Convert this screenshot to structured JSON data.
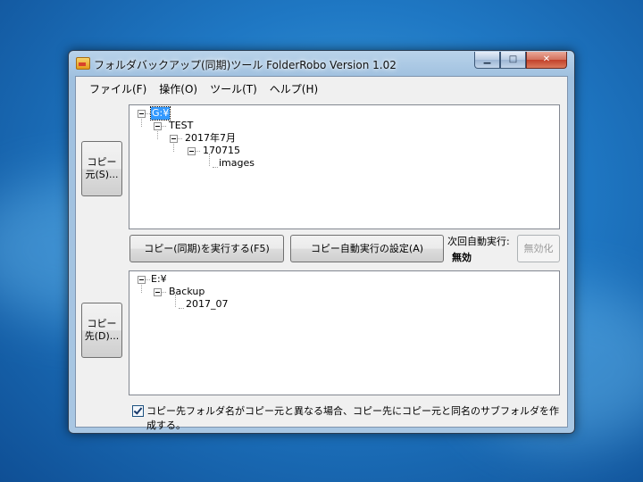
{
  "window": {
    "title": "フォルダバックアップ(同期)ツール FolderRobo Version 1.02"
  },
  "caption_buttons": {
    "minimize": "▁",
    "maximize": "□",
    "close": "✕"
  },
  "menu": [
    "ファイル(F)",
    "操作(O)",
    "ツール(T)",
    "ヘルプ(H)"
  ],
  "source_button": {
    "line1": "コピー",
    "line2": "元(S)..."
  },
  "dest_button": {
    "line1": "コピー",
    "line2": "先(D)..."
  },
  "source_tree": {
    "root": "G:¥",
    "level1": "TEST",
    "level2": "2017年7月",
    "level3": "170715",
    "level4": "images"
  },
  "dest_tree": {
    "root": "E:¥",
    "level1": "Backup",
    "level2": "2017_07"
  },
  "actions": {
    "run_sync": "コピー(同期)を実行する(F5)",
    "auto_settings": "コピー自動実行の設定(A)",
    "disable": "無効化"
  },
  "schedule": {
    "label": "次回自動実行:",
    "value": "無効"
  },
  "option": {
    "checked": true,
    "label": "コピー先フォルダ名がコピー元と異なる場合、コピー先にコピー元と同名のサブフォルダを作成する。"
  }
}
